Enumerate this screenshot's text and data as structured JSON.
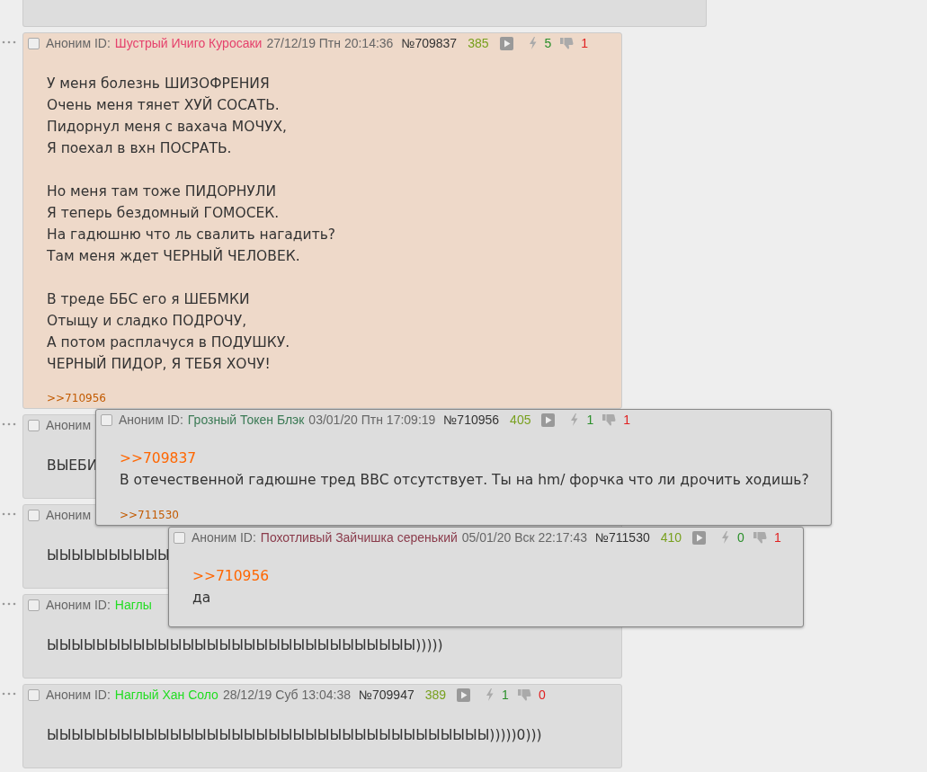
{
  "posts": [
    {
      "kind": "fragment"
    },
    {
      "kind": "post",
      "highlighted": true,
      "checked": false,
      "header": {
        "author": "Аноним ID:",
        "name": "Шустрый Ичиго Куросаки",
        "color": "#e5416c",
        "date": "27/12/19 Птн 20:14:36",
        "number": "№709837",
        "count": "385",
        "likes": "5",
        "dislikes": "1"
      },
      "paragraphs": [
        [
          "У меня болезнь ШИЗОФРЕНИЯ",
          "Очень меня тянет ХУЙ СОСАТЬ.",
          "Пидорнул меня с вахача МОЧУХ,",
          "Я поехал в вхн ПОСРАТЬ."
        ],
        [
          "Но меня там тоже ПИДОРНУЛИ",
          "Я теперь бездомный ГОМОСЕК.",
          "На гадюшню что ль свалить нагадить?",
          "Там меня ждет ЧЕРНЫЙ ЧЕЛОВЕК."
        ],
        [
          "В треде ББС его я ШЕБМКИ",
          "Отыщу и сладко ПОДРОЧУ,",
          "А потом расплачуся в ПОДУШКУ.",
          "ЧЕРНЫЙ ПИДОР, Я ТЕБЯ ХОЧУ!"
        ]
      ],
      "replies": [
        ">>710956"
      ]
    },
    {
      "kind": "post",
      "highlighted": false,
      "checked": false,
      "header": {
        "author": "Аноним"
      },
      "paragraphs": [
        [
          "ВЫЕБИ"
        ]
      ]
    },
    {
      "kind": "post",
      "highlighted": false,
      "checked": false,
      "header": {
        "author": "Аноним"
      },
      "paragraphs": [
        [
          "ЫЫЫЫЫЫЫЫЫЫ"
        ]
      ]
    },
    {
      "kind": "post",
      "highlighted": false,
      "checked": false,
      "header": {
        "author": "Аноним ID:",
        "name": "Наглы",
        "color": "#22dd22"
      },
      "paragraphs": [
        [
          "ЫЫЫЫЫЫЫЫЫЫЫЫЫЫЫЫЫЫЫЫЫЫЫЫЫЫЫЫЫЫ)))))"
        ]
      ]
    },
    {
      "kind": "post",
      "highlighted": false,
      "checked": false,
      "header": {
        "author": "Аноним ID:",
        "name": "Наглый Хан Соло",
        "color": "#22dd22",
        "date": "28/12/19 Суб 13:04:38",
        "number": "№709947",
        "count": "389",
        "likes": "1",
        "dislikes": "0"
      },
      "paragraphs": [
        [
          "ЫЫЫЫЫЫЫЫЫЫЫЫЫЫЫЫЫЫЫЫЫЫЫЫЫЫЫЫЫЫЫЫЫЫЫЫ)))))0)))"
        ]
      ]
    }
  ],
  "popups": [
    {
      "checked": false,
      "header": {
        "author": "Аноним ID:",
        "name": "Грозный Токен Блэк",
        "color": "#3b7a55",
        "date": "03/01/20 Птн 17:09:19",
        "number": "№710956",
        "count": "405",
        "likes": "1",
        "dislikes": "1"
      },
      "quote": ">>709837",
      "paragraphs": [
        [
          "В отечественной гадюшне тред ВВС отсутствует. Ты на hm/ форчка что ли дрочить ходишь?"
        ]
      ],
      "replies": [
        ">>711530"
      ]
    },
    {
      "checked": false,
      "header": {
        "author": "Аноним ID:",
        "name": "Похотливый Зайчишка серенький",
        "color": "#8a3b4b",
        "date": "05/01/20 Вск 22:17:43",
        "number": "№711530",
        "count": "410",
        "likes": "0",
        "dislikes": "1"
      },
      "quote": ">>710956",
      "paragraphs": [
        [
          "да"
        ]
      ]
    }
  ]
}
